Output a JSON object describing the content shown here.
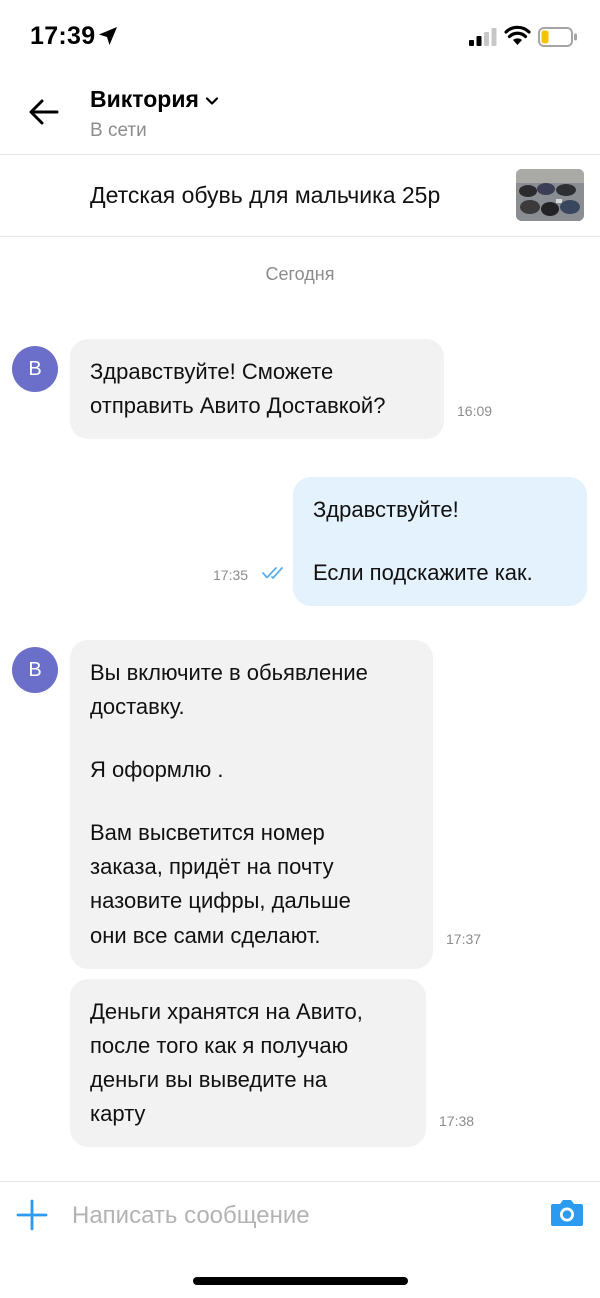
{
  "status_bar": {
    "time": "17:39",
    "battery_level": 0.25,
    "battery_color": "#f5c400"
  },
  "header": {
    "contact_name": "Виктория",
    "contact_status": "В сети"
  },
  "listing": {
    "title": "Детская обувь для мальчика 25р",
    "thumb_icon": "shoes-photo"
  },
  "date_separator": "Сегодня",
  "messages": [
    {
      "direction": "in",
      "avatar": "В",
      "paragraphs": [
        "Здравствуйте! Сможете\nотправить Авито Доставкой?"
      ],
      "time": "16:09"
    },
    {
      "direction": "out",
      "paragraphs": [
        "Здравствуйте!",
        "Если подскажите как."
      ],
      "time": "17:35",
      "status_icon": "double-check-icon"
    },
    {
      "direction": "in",
      "avatar": "В",
      "paragraphs": [
        "Вы включите в обьявление\nдоставку.",
        "Я оформлю .",
        "Вам высветится номер\nзаказа, придёт на почту\nназовите цифры, дальше\nони все сами сделают."
      ],
      "time": "17:37"
    },
    {
      "direction": "in",
      "paragraphs": [
        "Деньги хранятся на Авито,\nпосле того как я получаю\nденьги вы выведите на\nкарту"
      ],
      "time": "17:38"
    }
  ],
  "composer": {
    "placeholder": "Написать сообщение"
  },
  "colors": {
    "accent": "#2a9bf0",
    "avatar_bg": "#6b6fc9",
    "incoming_bubble": "#f2f2f2",
    "outgoing_bubble": "#e4f2fd",
    "secondary_text": "#8c8c8c"
  }
}
